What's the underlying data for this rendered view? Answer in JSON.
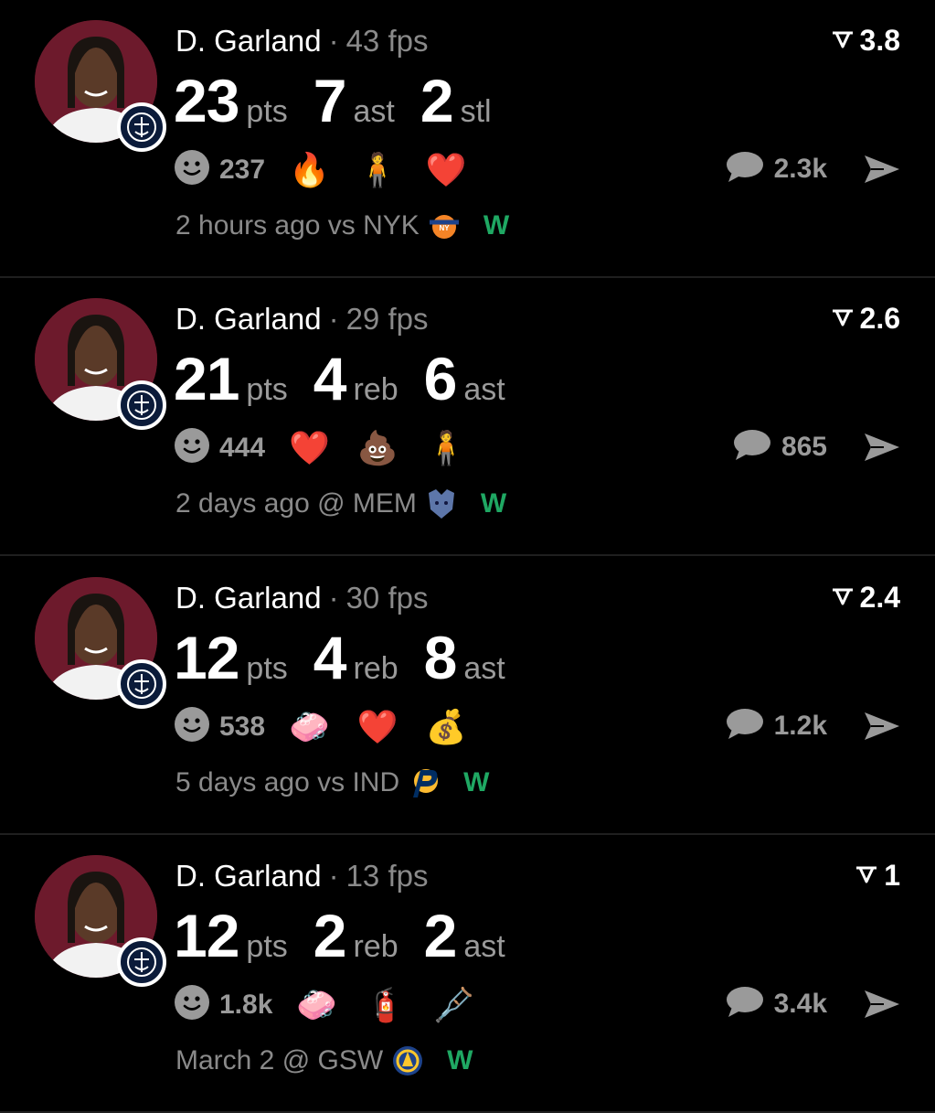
{
  "posts": [
    {
      "player": "D. Garland",
      "fps": "43 fps",
      "score": "3.8",
      "stats": [
        {
          "num": "23",
          "unit": "pts"
        },
        {
          "num": "7",
          "unit": "ast"
        },
        {
          "num": "2",
          "unit": "stl"
        }
      ],
      "reaction_count": "237",
      "emojis": [
        "🔥",
        "🧍",
        "❤️"
      ],
      "comment_count": "2.3k",
      "time": "2 hours ago",
      "matchup": "vs NYK",
      "opponent_logo": "knicks-logo-icon",
      "result": "W"
    },
    {
      "player": "D. Garland",
      "fps": "29 fps",
      "score": "2.6",
      "stats": [
        {
          "num": "21",
          "unit": "pts"
        },
        {
          "num": "4",
          "unit": "reb"
        },
        {
          "num": "6",
          "unit": "ast"
        }
      ],
      "reaction_count": "444",
      "emojis": [
        "❤️",
        "💩",
        "🧍"
      ],
      "comment_count": "865",
      "time": "2 days ago",
      "matchup": "@ MEM",
      "opponent_logo": "grizzlies-logo-icon",
      "result": "W"
    },
    {
      "player": "D. Garland",
      "fps": "30 fps",
      "score": "2.4",
      "stats": [
        {
          "num": "12",
          "unit": "pts"
        },
        {
          "num": "4",
          "unit": "reb"
        },
        {
          "num": "8",
          "unit": "ast"
        }
      ],
      "reaction_count": "538",
      "emojis": [
        "🧼",
        "❤️",
        "💰"
      ],
      "comment_count": "1.2k",
      "time": "5 days ago",
      "matchup": "vs IND",
      "opponent_logo": "pacers-logo-icon",
      "result": "W"
    },
    {
      "player": "D. Garland",
      "fps": "13 fps",
      "score": "1",
      "stats": [
        {
          "num": "12",
          "unit": "pts"
        },
        {
          "num": "2",
          "unit": "reb"
        },
        {
          "num": "2",
          "unit": "ast"
        }
      ],
      "reaction_count": "1.8k",
      "emojis": [
        "🧼",
        "🧯",
        "🩼"
      ],
      "comment_count": "3.4k",
      "time": "March 2",
      "matchup": "@ GSW",
      "opponent_logo": "warriors-logo-icon",
      "result": "W"
    }
  ],
  "colors": {
    "background": "#000000",
    "win": "#1fa863",
    "muted": "#8a8a8a",
    "avatar_bg": "#6d1a2c"
  }
}
